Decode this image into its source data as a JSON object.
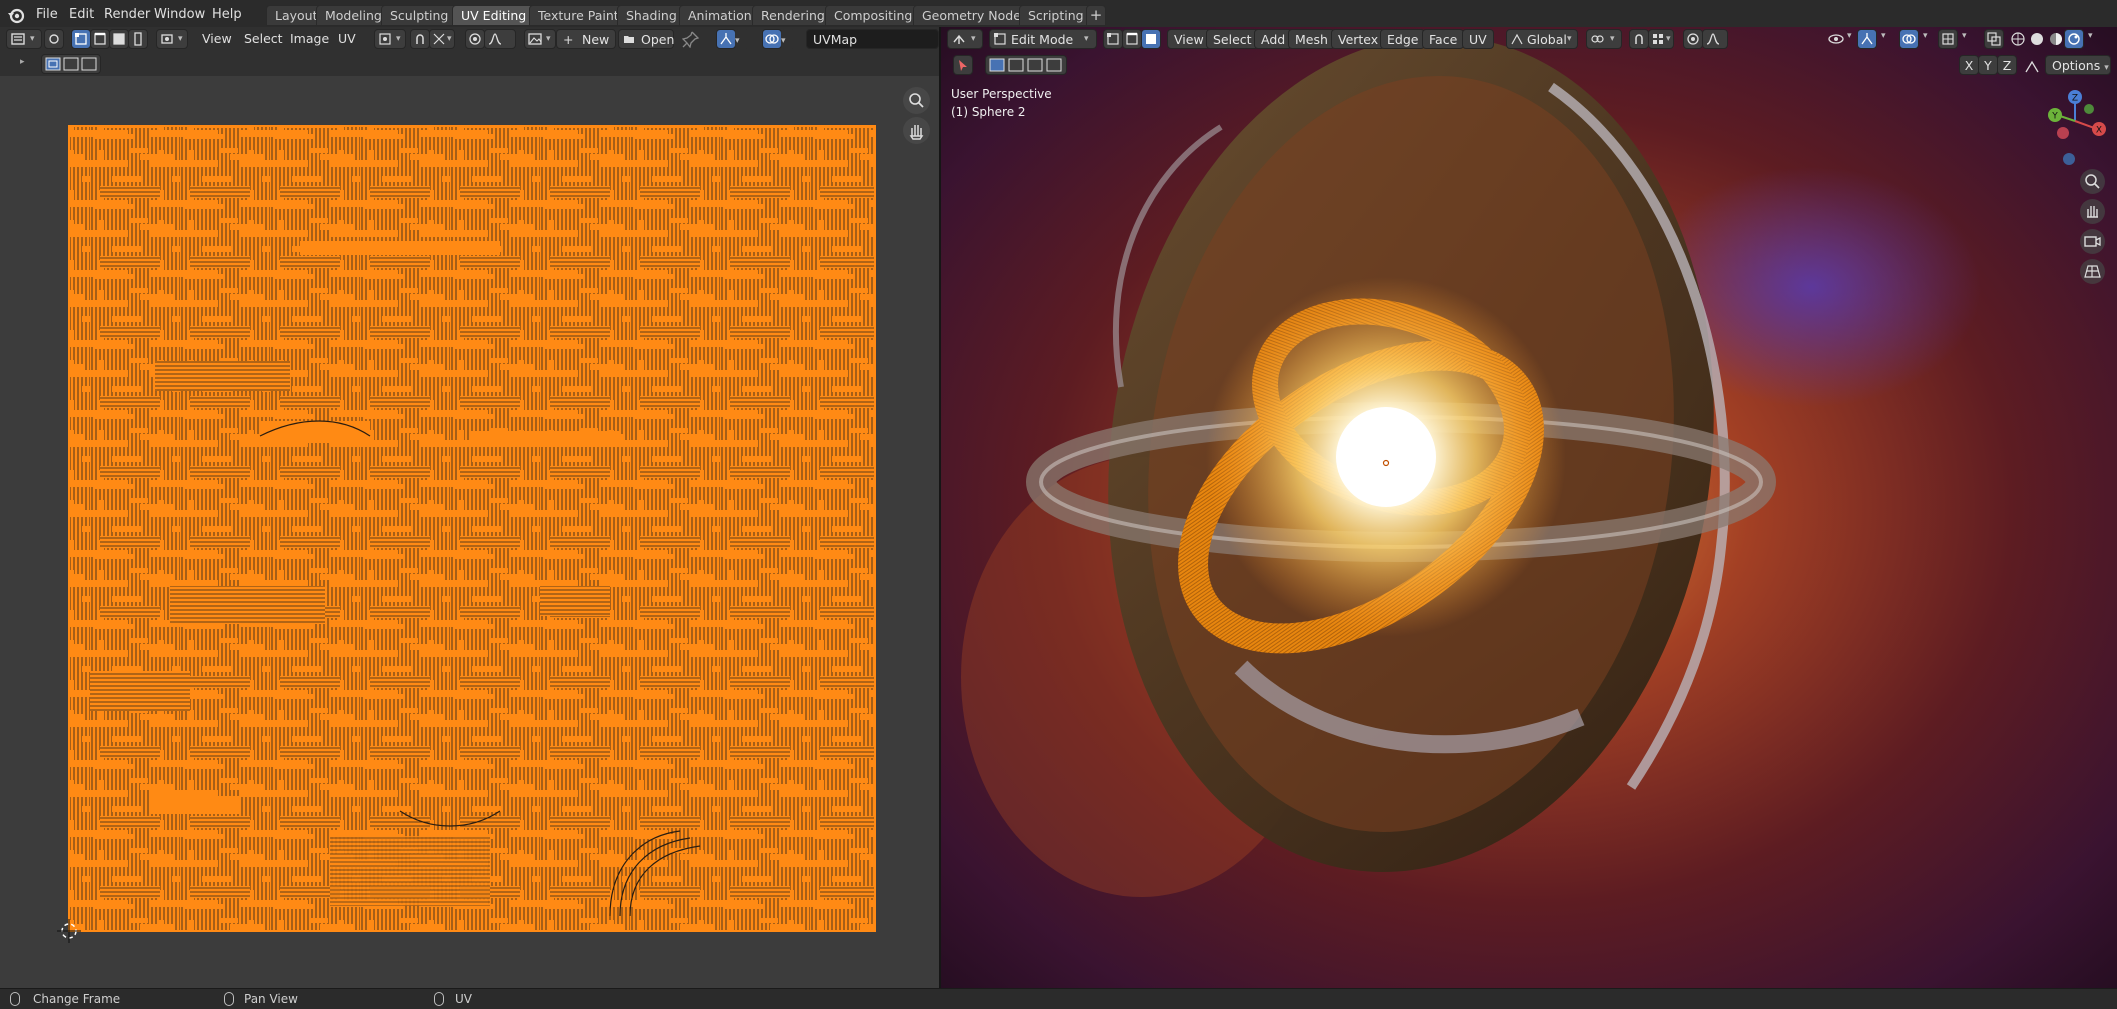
{
  "menubar": {
    "items": [
      "File",
      "Edit",
      "Render",
      "Window",
      "Help"
    ],
    "workspace_tabs": [
      "Layout",
      "Modeling",
      "Sculpting",
      "UV Editing",
      "Texture Paint",
      "Shading",
      "Animation",
      "Rendering",
      "Compositing",
      "Geometry Nodes",
      "Scripting"
    ],
    "active_tab": "UV Editing",
    "add_tab_label": "+"
  },
  "uv_editor": {
    "menus": [
      "View",
      "Select",
      "Image",
      "UV"
    ],
    "new_label": "New",
    "open_label": "Open",
    "uvmap_value": "UVMap"
  },
  "viewport": {
    "mode_label": "Edit Mode",
    "menus": [
      "View",
      "Select",
      "Add",
      "Mesh",
      "Vertex",
      "Edge",
      "Face",
      "UV"
    ],
    "orientation_label": "Global",
    "axis_x": "X",
    "axis_y": "Y",
    "axis_z": "Z",
    "options_label": "Options",
    "perspective_label": "User Perspective",
    "object_label": "(1) Sphere 2",
    "gizmo": {
      "x": "X",
      "y": "Y",
      "z": "Z"
    }
  },
  "statusbar": {
    "items": [
      "Change Frame",
      "Pan View",
      "UV"
    ]
  },
  "colors": {
    "uv_orange": "#ff8a14",
    "active_blue": "#4772b3",
    "header_bg": "#303030",
    "uv_bg": "#3c3c3c"
  },
  "icons": [
    "blender-logo-icon",
    "editor-type-icon",
    "sync-selection-icon",
    "vertex-select-icon",
    "edge-select-icon",
    "face-select-icon",
    "island-select-icon",
    "pivot-icon",
    "snap-icon",
    "proportional-edit-icon",
    "image-browse-icon",
    "pin-icon",
    "gizmo-icon",
    "overlay-icon",
    "zoom-icon",
    "hand-pan-icon",
    "camera-icon",
    "grid-view-icon",
    "cursor-icon",
    "mouse-icon"
  ]
}
